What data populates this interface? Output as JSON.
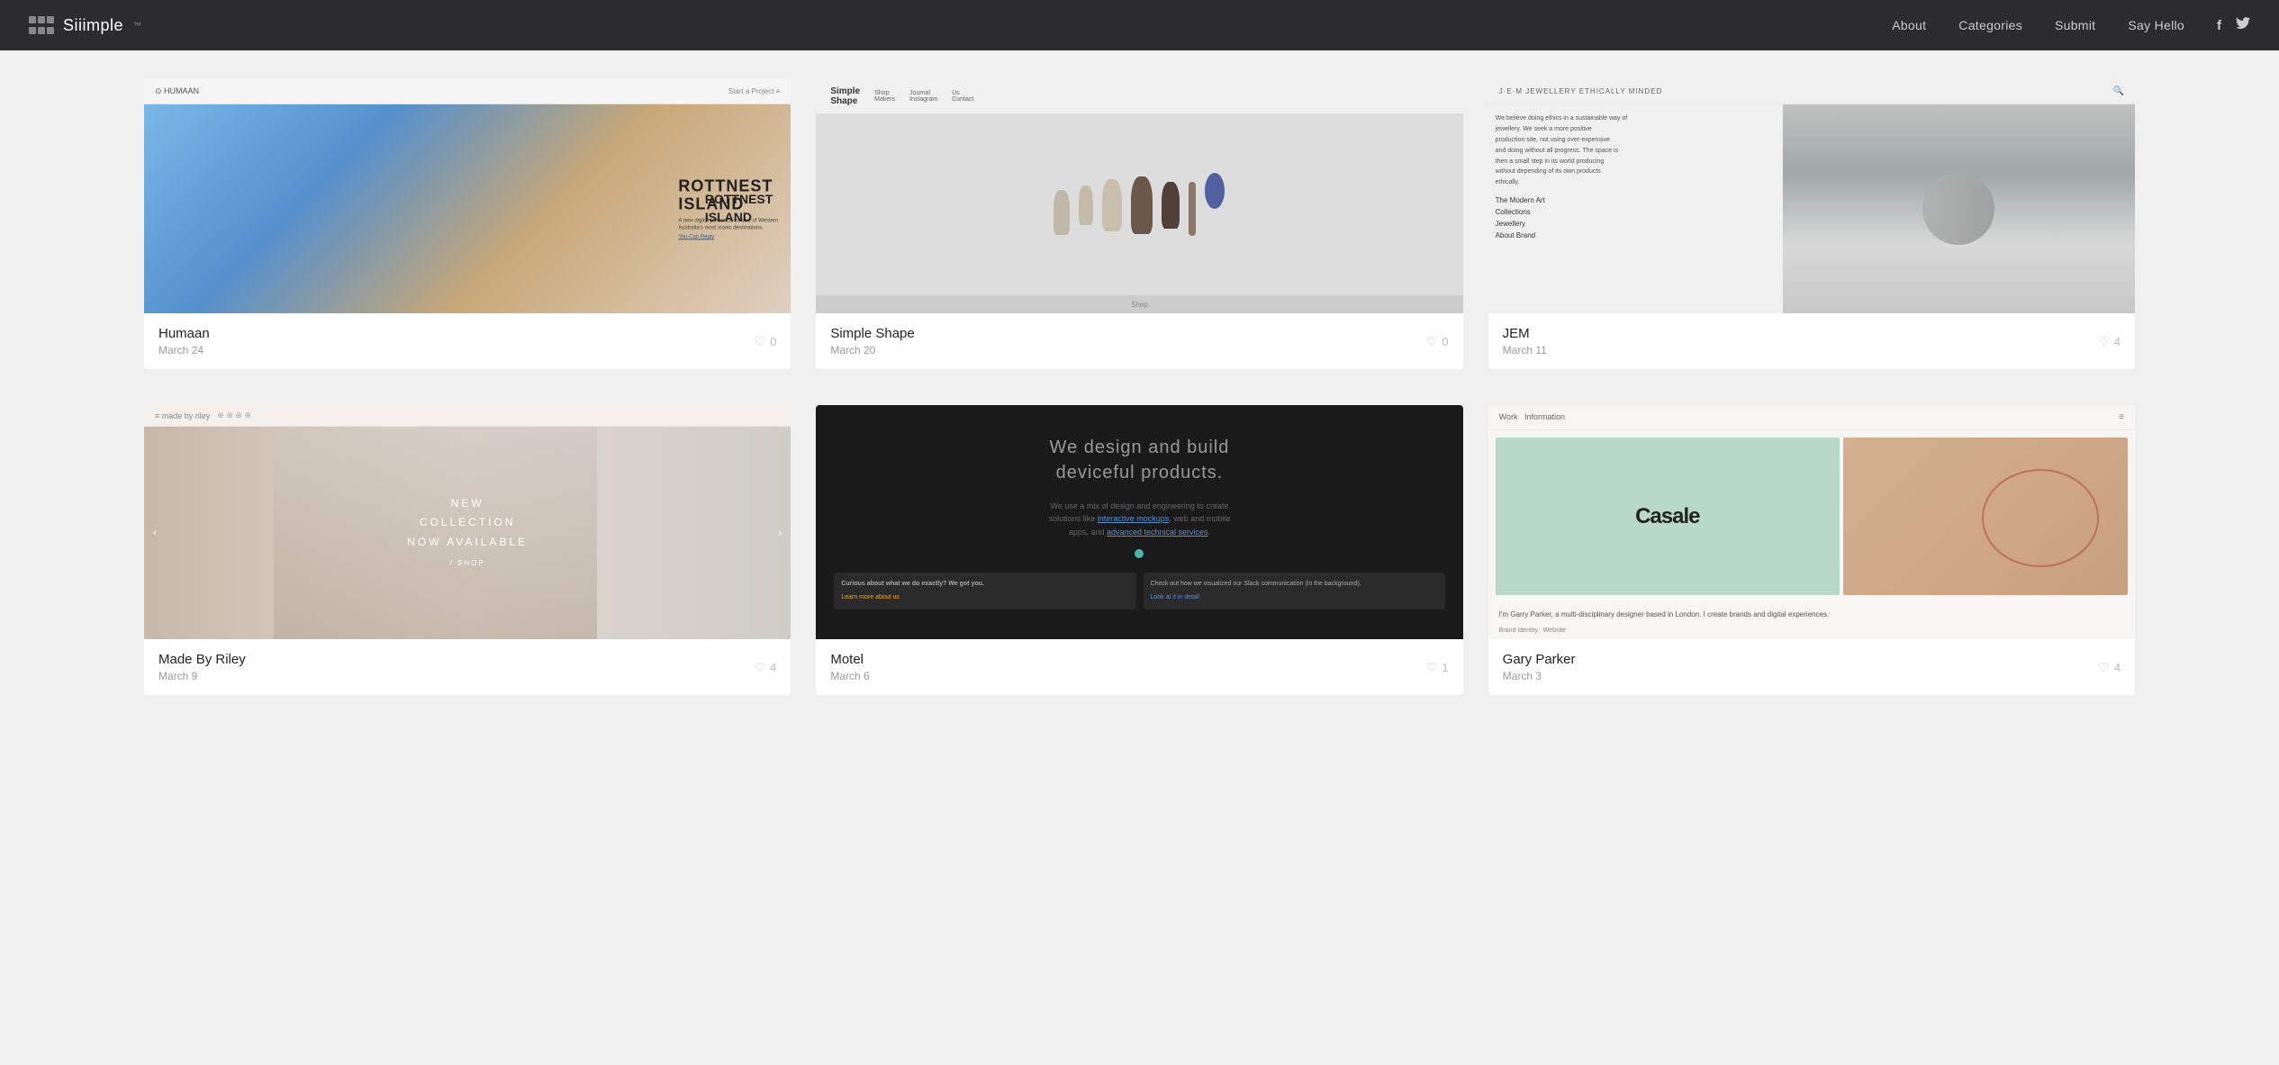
{
  "nav": {
    "logo_text": "Siiimple",
    "logo_tm": "™",
    "links": [
      {
        "label": "About",
        "href": "#"
      },
      {
        "label": "Categories",
        "href": "#"
      },
      {
        "label": "Submit",
        "href": "#"
      },
      {
        "label": "Say Hello",
        "href": "#"
      }
    ],
    "social": [
      {
        "label": "Facebook",
        "icon": "f"
      },
      {
        "label": "Twitter",
        "icon": "🐦"
      }
    ]
  },
  "cards": [
    {
      "id": "humaan",
      "title": "Humaan",
      "date": "March 24",
      "likes": 0,
      "thumb_type": "humaan"
    },
    {
      "id": "simpleshape",
      "title": "Simple Shape",
      "date": "March 20",
      "likes": 0,
      "thumb_type": "simpleshape"
    },
    {
      "id": "jem",
      "title": "JEM",
      "date": "March 11",
      "likes": 4,
      "thumb_type": "jem"
    },
    {
      "id": "madebyriley",
      "title": "Made By Riley",
      "date": "March 9",
      "likes": 4,
      "thumb_type": "madebyriley"
    },
    {
      "id": "motel",
      "title": "Motel",
      "date": "March 6",
      "likes": 1,
      "thumb_type": "motel"
    },
    {
      "id": "garyparker",
      "title": "Gary Parker",
      "date": "March 3",
      "likes": 4,
      "thumb_type": "garyparker"
    }
  ]
}
